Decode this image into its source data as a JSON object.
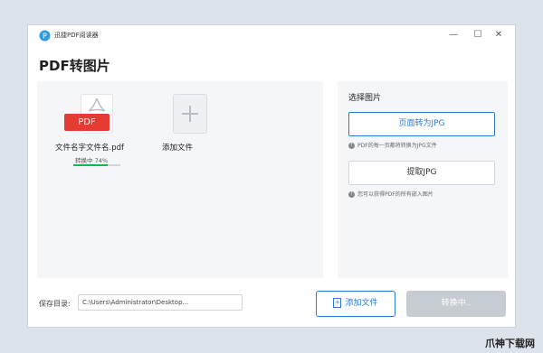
{
  "window": {
    "title": "迅捷PDF阅读器"
  },
  "page": {
    "title": "PDF转图片"
  },
  "file": {
    "badge": "PDF",
    "name": "文件名字文件名.pdf",
    "status": "转换中  74%",
    "progress": 0.74
  },
  "add_tile": {
    "label": "添加文件"
  },
  "options": {
    "section_title": "选择图片",
    "to_jpg_label": "页面转为JPG",
    "to_jpg_hint": "PDF的每一页都将转换为JPG文件",
    "extract_label": "提取JPG",
    "extract_hint": "您可以获得PDF的所有嵌入图片"
  },
  "footer": {
    "save_label": "保存目录:",
    "save_path": "C:\\Users\\Administrator\\Desktop...",
    "browse_label": "•••",
    "add_button": "添加文件",
    "convert_button": "转换中.."
  },
  "watermark": "爪神下载网",
  "colors": {
    "accent": "#2f78d6",
    "pdf_red": "#e63b33",
    "progress_green": "#16b64a"
  }
}
